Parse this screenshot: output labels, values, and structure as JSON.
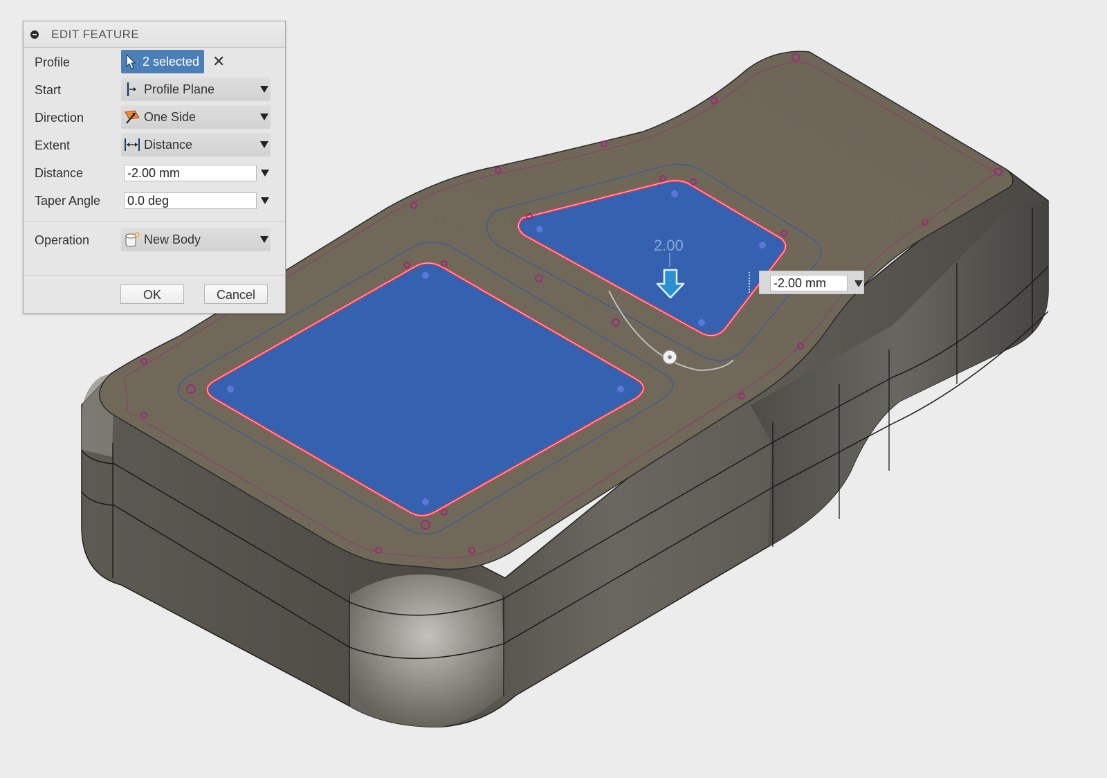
{
  "dialog": {
    "title": "EDIT FEATURE",
    "rows": {
      "profile": {
        "label": "Profile",
        "value": "2 selected"
      },
      "start": {
        "label": "Start",
        "value": "Profile Plane"
      },
      "direction": {
        "label": "Direction",
        "value": "One Side"
      },
      "extent": {
        "label": "Extent",
        "value": "Distance"
      },
      "distance": {
        "label": "Distance",
        "value": "-2.00 mm"
      },
      "taper": {
        "label": "Taper Angle",
        "value": "0.0 deg"
      },
      "operation": {
        "label": "Operation",
        "value": "New Body"
      }
    },
    "ok_label": "OK",
    "cancel_label": "Cancel"
  },
  "viewport": {
    "dimension_label": "2.00",
    "manipulator_value": "-2.00 mm"
  },
  "colors": {
    "top_face": "#6f6758",
    "side_face": "#5a5750",
    "profile_fill": "#3562b0",
    "profile_edge": "#e8384a",
    "manipulator_arrow": "#2b8fd0",
    "selection_blue": "#4b7fb8"
  },
  "icons": {
    "select": "cursor-arrow-icon",
    "clear": "close-x-icon",
    "start": "profile-plane-icon",
    "direction": "one-side-icon",
    "extent": "distance-icon",
    "operation": "new-body-icon",
    "manipulator": "down-arrow-icon"
  }
}
